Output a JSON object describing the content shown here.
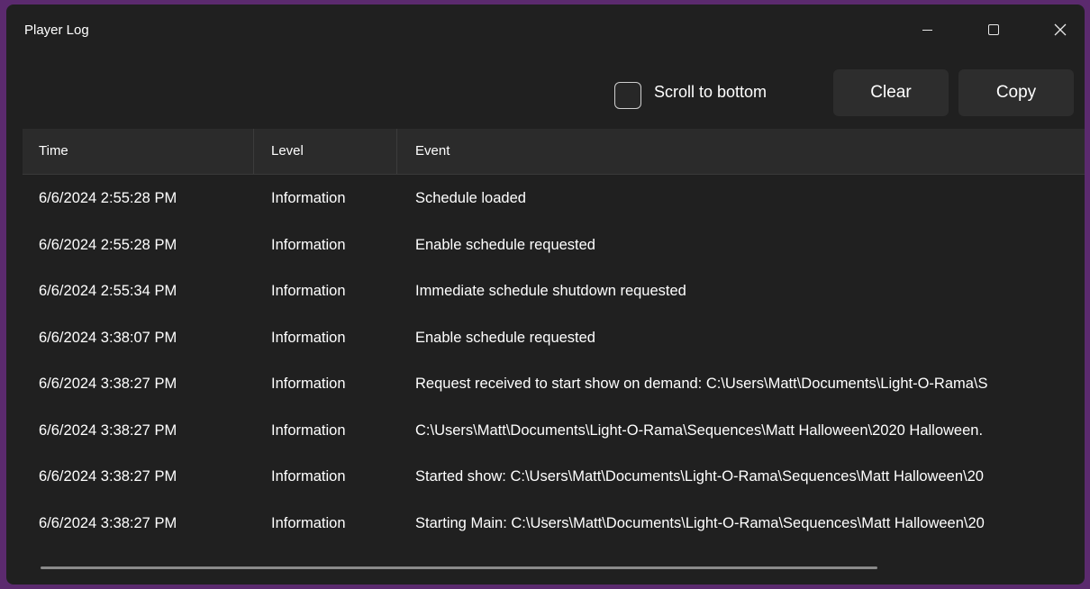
{
  "window": {
    "title": "Player Log"
  },
  "toolbar": {
    "scroll_to_bottom_label": "Scroll to bottom",
    "scroll_to_bottom_checked": false,
    "clear_label": "Clear",
    "copy_label": "Copy"
  },
  "grid": {
    "columns": [
      "Time",
      "Level",
      "Event"
    ],
    "rows": [
      {
        "time": "6/6/2024 2:55:28 PM",
        "level": "Information",
        "event": "Schedule loaded"
      },
      {
        "time": "6/6/2024 2:55:28 PM",
        "level": "Information",
        "event": "Enable schedule requested"
      },
      {
        "time": "6/6/2024 2:55:34 PM",
        "level": "Information",
        "event": "Immediate schedule shutdown requested"
      },
      {
        "time": "6/6/2024 3:38:07 PM",
        "level": "Information",
        "event": "Enable schedule requested"
      },
      {
        "time": "6/6/2024 3:38:27 PM",
        "level": "Information",
        "event": "Request received to start show on demand: C:\\Users\\Matt\\Documents\\Light-O-Rama\\S"
      },
      {
        "time": "6/6/2024 3:38:27 PM",
        "level": "Information",
        "event": "C:\\Users\\Matt\\Documents\\Light-O-Rama\\Sequences\\Matt Halloween\\2020 Halloween."
      },
      {
        "time": "6/6/2024 3:38:27 PM",
        "level": "Information",
        "event": "Started show: C:\\Users\\Matt\\Documents\\Light-O-Rama\\Sequences\\Matt Halloween\\20"
      },
      {
        "time": "6/6/2024 3:38:27 PM",
        "level": "Information",
        "event": "Starting Main: C:\\Users\\Matt\\Documents\\Light-O-Rama\\Sequences\\Matt Halloween\\20"
      }
    ]
  }
}
